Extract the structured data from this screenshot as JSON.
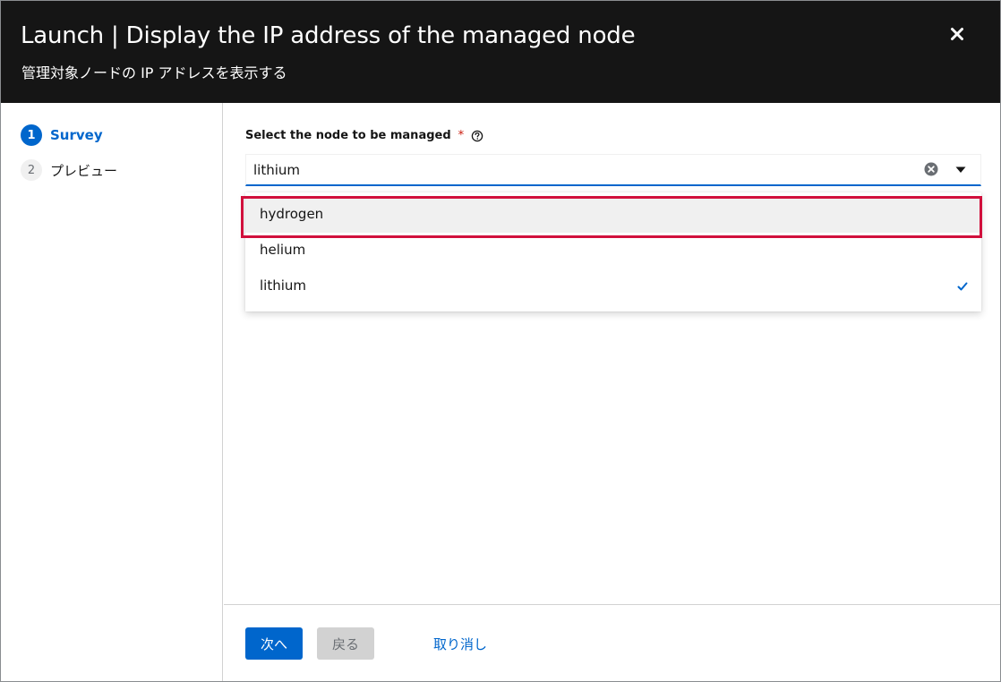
{
  "modal": {
    "title": "Launch | Display the IP address of the managed node",
    "subtitle": "管理対象ノードの IP アドレスを表示する"
  },
  "nav": {
    "items": [
      {
        "number": "1",
        "label": "Survey",
        "active": true
      },
      {
        "number": "2",
        "label": "プレビュー",
        "active": false
      }
    ]
  },
  "survey": {
    "field_label": "Select the node to be managed",
    "required_marker": "*",
    "selected_value": "lithium",
    "options": [
      {
        "label": "hydrogen",
        "hovered": true,
        "selected": false
      },
      {
        "label": "helium",
        "hovered": false,
        "selected": false
      },
      {
        "label": "lithium",
        "hovered": false,
        "selected": true
      }
    ]
  },
  "footer": {
    "next_label": "次へ",
    "back_label": "戻る",
    "cancel_label": "取り消し"
  },
  "colors": {
    "header_bg": "#151515",
    "accent": "#0066cc",
    "required": "#c9190b",
    "highlight": "#d1103c",
    "disabled_bg": "#d2d2d2"
  },
  "icons": [
    "close-icon",
    "help-icon",
    "clear-icon",
    "caret-down-icon",
    "check-icon"
  ]
}
